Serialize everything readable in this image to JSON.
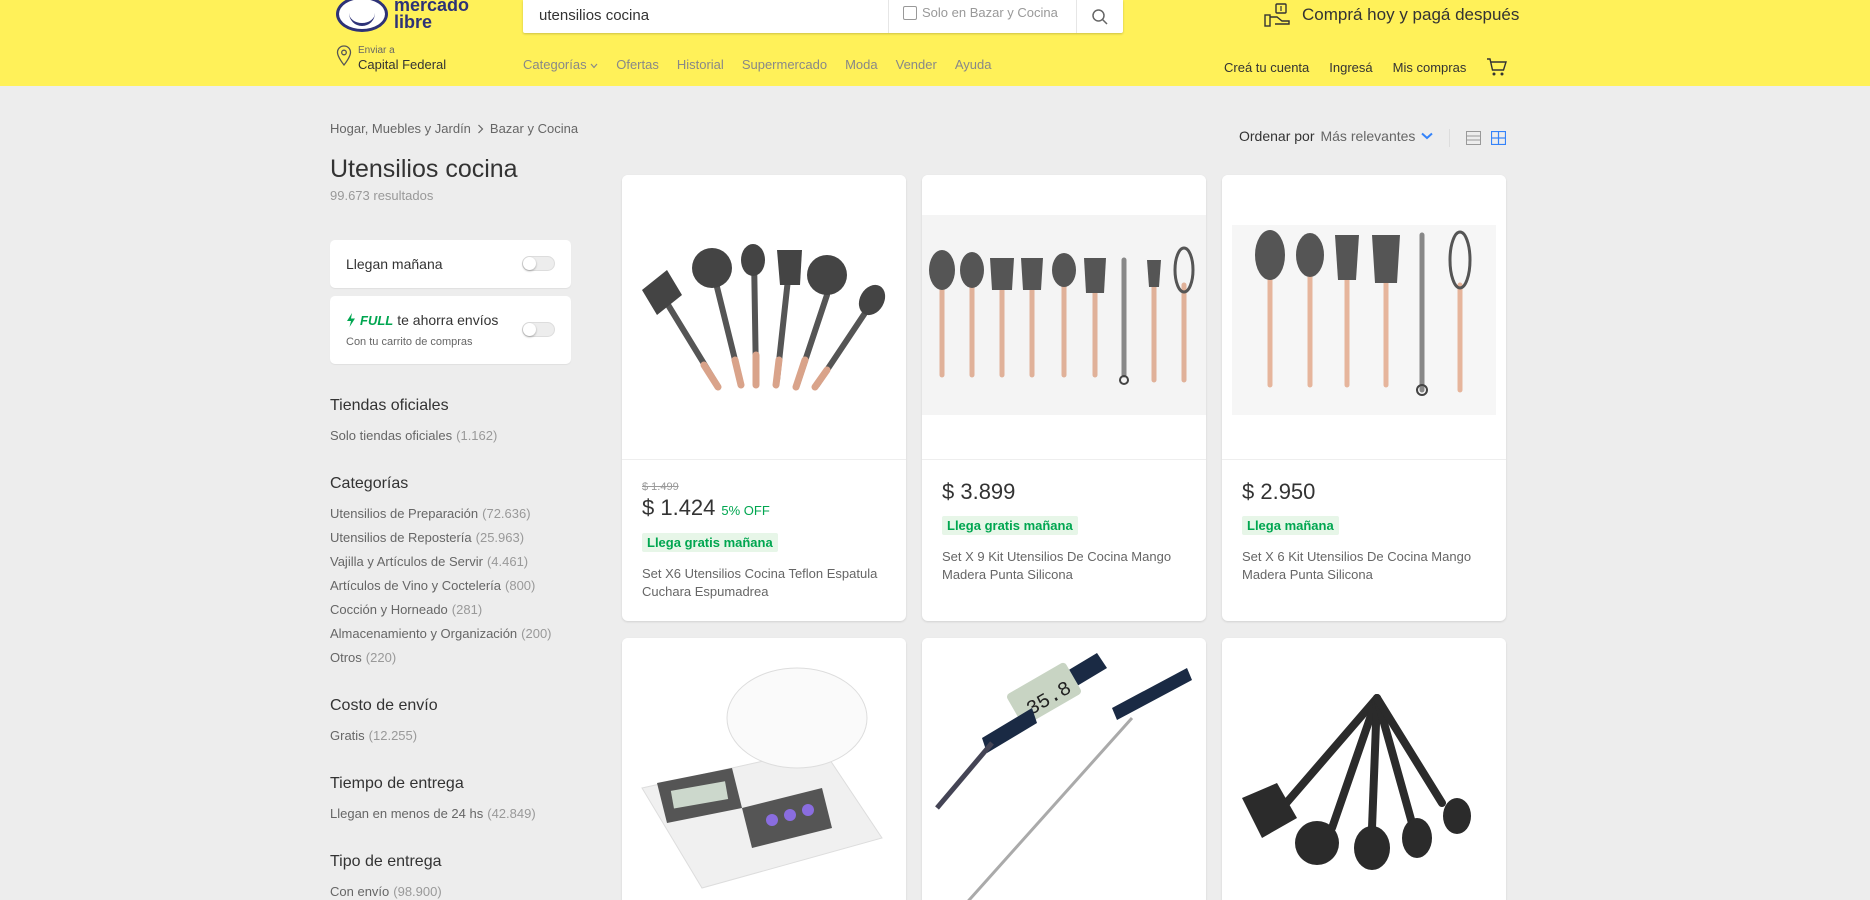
{
  "header": {
    "logo_text": "mercado libre",
    "search_value": "utensilios cocina",
    "search_scope_label": "Solo en Bazar y Cocina",
    "promo": "Comprá hoy y pagá después",
    "location_small": "Enviar a",
    "location_big": "Capital Federal",
    "nav": [
      "Categorías",
      "Ofertas",
      "Historial",
      "Supermercado",
      "Moda",
      "Vender",
      "Ayuda"
    ],
    "user_nav": [
      "Creá tu cuenta",
      "Ingresá",
      "Mis compras"
    ]
  },
  "breadcrumb": [
    "Hogar, Muebles y Jardín",
    "Bazar y Cocina"
  ],
  "page_title": "Utensilios cocina",
  "results": "99.673 resultados",
  "quick_filters": {
    "tomorrow": "Llegan mañana",
    "full_badge": "FULL",
    "full_label": "te ahorra envíos",
    "full_sub": "Con tu carrito de compras"
  },
  "filters": {
    "official": {
      "title": "Tiendas oficiales",
      "items": [
        {
          "label": "Solo tiendas oficiales",
          "count": "(1.162)"
        }
      ]
    },
    "categories": {
      "title": "Categorías",
      "items": [
        {
          "label": "Utensilios de Preparación",
          "count": "(72.636)"
        },
        {
          "label": "Utensilios de Repostería",
          "count": "(25.963)"
        },
        {
          "label": "Vajilla y Artículos de Servir",
          "count": "(4.461)"
        },
        {
          "label": "Artículos de Vino y Coctelería",
          "count": "(800)"
        },
        {
          "label": "Cocción y Horneado",
          "count": "(281)"
        },
        {
          "label": "Almacenamiento y Organización",
          "count": "(200)"
        },
        {
          "label": "Otros",
          "count": "(220)"
        }
      ]
    },
    "shipping_cost": {
      "title": "Costo de envío",
      "items": [
        {
          "label": "Gratis",
          "count": "(12.255)"
        }
      ]
    },
    "delivery_time": {
      "title": "Tiempo de entrega",
      "items": [
        {
          "label": "Llegan en menos de 24 hs",
          "count": "(42.849)"
        }
      ]
    },
    "delivery_type": {
      "title": "Tipo de entrega",
      "items": [
        {
          "label": "Con envío",
          "count": "(98.900)"
        }
      ]
    }
  },
  "sort": {
    "label": "Ordenar por",
    "value": "Más relevantes"
  },
  "products": [
    {
      "old_price": "$ 1.499",
      "price": "$ 1.424",
      "discount": "5% OFF",
      "shipping": "Llega gratis mañana",
      "title": "Set X6 Utensilios Cocina Teflon Espatula Cuchara Espumadrea"
    },
    {
      "price": "$ 3.899",
      "shipping": "Llega gratis mañana",
      "title": "Set X 9 Kit Utensilios De Cocina Mango Madera Punta Silicona"
    },
    {
      "price": "$ 2.950",
      "shipping": "Llega mañana",
      "title": "Set X 6 Kit Utensilios De Cocina Mango Madera Punta Silicona"
    },
    {},
    {
      "thermo_reading": "35.8"
    },
    {}
  ],
  "colors": {
    "header_bg": "#fff159",
    "accent_blue": "#3483fa",
    "green": "#00a650"
  }
}
